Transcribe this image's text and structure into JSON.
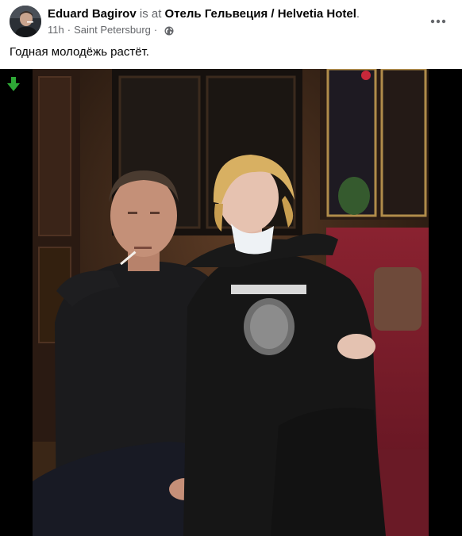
{
  "post": {
    "author": "Eduard Bagirov",
    "is_at": "is at",
    "place": "Отель Гельвеция / Helvetia Hotel",
    "place_suffix": ".",
    "time": "11h",
    "separator": "·",
    "location": "Saint Petersburg",
    "separator2": "·",
    "privacy_icon": "globe-icon",
    "text": "Годная молодёжь растёт."
  },
  "icons": {
    "more": "more-horizontal-icon",
    "download": "down-arrow-icon"
  },
  "colors": {
    "name": "#050505",
    "secondary": "#65676b",
    "arrow": "#2ea836",
    "photo_bg": "#000000"
  }
}
